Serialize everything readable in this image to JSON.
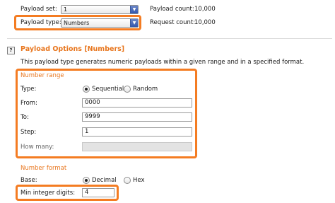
{
  "payload_set": {
    "label": "Payload set:",
    "value": "1",
    "count_label": "Payload count:",
    "count_value": "10,000"
  },
  "payload_type": {
    "label": "Payload type:",
    "value": "Numbers",
    "request_label": "Request count:",
    "request_value": "10,000"
  },
  "payload_options": {
    "help_icon": "?",
    "title": "Payload Options [Numbers]",
    "description": "This payload type generates numeric payloads within a given range and in a specified format."
  },
  "number_range": {
    "title": "Number range",
    "type_label": "Type:",
    "sequential_label": "Sequential",
    "random_label": "Random",
    "selected": "Sequential",
    "from_label": "From:",
    "from_value": "0000",
    "to_label": "To:",
    "to_value": "9999",
    "step_label": "Step:",
    "step_value": "1",
    "how_many_label": "How many:",
    "how_many_value": ""
  },
  "number_format": {
    "title": "Number format",
    "base_label": "Base:",
    "decimal_label": "Decimal",
    "hex_label": "Hex",
    "selected": "Decimal",
    "min_int_label": "Min integer digits:",
    "min_int_value": "4"
  },
  "colors": {
    "highlight": "#f47c22",
    "section_title": "#e8761e",
    "combo_arrow": "#3357ad"
  },
  "icons": {
    "combo_arrow": "chevron-down-icon",
    "help": "help-icon"
  }
}
